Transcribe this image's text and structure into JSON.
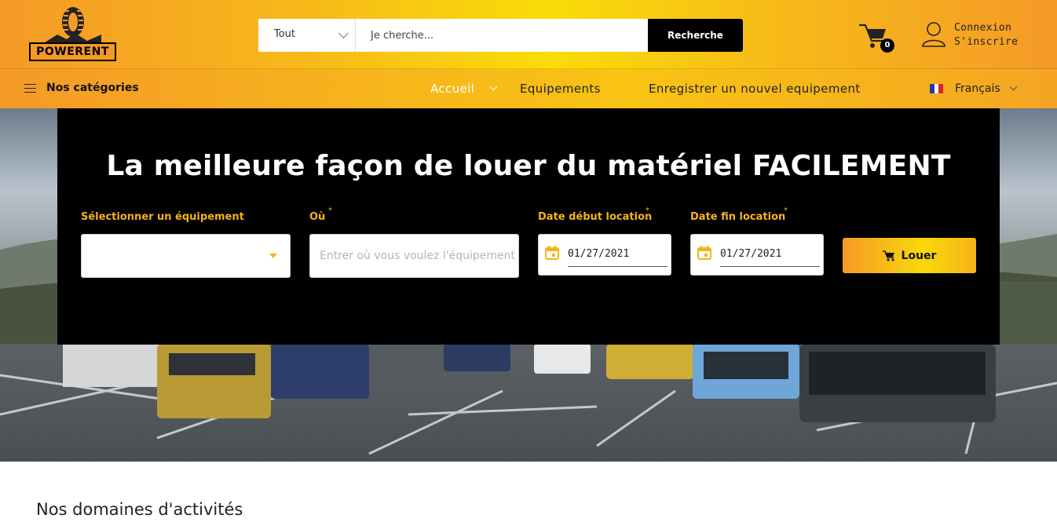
{
  "header": {
    "logo_text": "POWERENT",
    "search": {
      "category": "Tout",
      "placeholder": "Je cherche...",
      "button": "Recherche"
    },
    "cart_count": "0",
    "account": {
      "login": "Connexion",
      "register": "S'inscrire"
    }
  },
  "nav": {
    "categories": "Nos catégories",
    "items": [
      "Accueil",
      "Equipements",
      "Enregistrer un nouvel equipement"
    ],
    "language": "Français"
  },
  "hero": {
    "title": "La meilleure façon de louer du matériel FACILEMENT",
    "fields": {
      "equipment_label": "Sélectionner un équipement",
      "where_label": "Où",
      "where_placeholder": "Entrer où vous voulez l'équipement",
      "start_label": "Date début location",
      "start_value": "01/27/2021",
      "end_label": "Date fin location",
      "end_value": "01/27/2021",
      "required_mark": "*"
    },
    "rent_button": "Louer"
  },
  "section_title": "Nos domaines d'activités",
  "colors": {
    "accent": "#f5b31a",
    "accent_orange": "#f59a27",
    "accent_yellow": "#f9dc08",
    "panel": "#000000"
  },
  "icons": [
    "cart-icon",
    "user-icon",
    "menu-icon",
    "flag-fr-icon",
    "calendar-icon",
    "cart-small-icon",
    "chevron-down-icon"
  ]
}
